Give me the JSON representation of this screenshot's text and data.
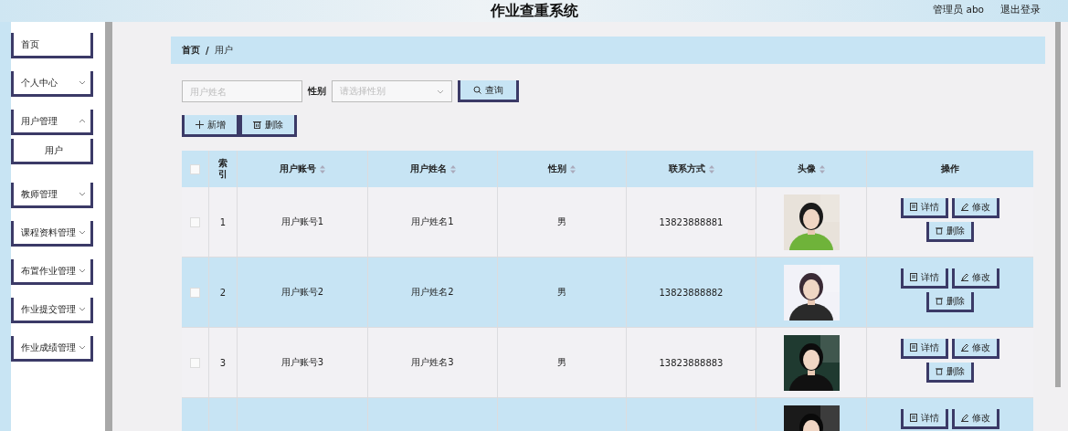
{
  "header": {
    "title": "作业查重系统",
    "user": "管理员 abo",
    "logout": "退出登录"
  },
  "sidebar": {
    "items": [
      {
        "label": "首页",
        "kind": "link"
      },
      {
        "label": "个人中心",
        "kind": "group",
        "expanded": false
      },
      {
        "label": "用户管理",
        "kind": "group",
        "expanded": true,
        "children": [
          {
            "label": "用户",
            "selected": true
          }
        ]
      },
      {
        "label": "教师管理",
        "kind": "group",
        "expanded": false
      },
      {
        "label": "课程资料管理",
        "kind": "group",
        "expanded": false
      },
      {
        "label": "布置作业管理",
        "kind": "group",
        "expanded": false
      },
      {
        "label": "作业提交管理",
        "kind": "group",
        "expanded": false
      },
      {
        "label": "作业成绩管理",
        "kind": "group",
        "expanded": false
      }
    ]
  },
  "breadcrumb": {
    "items": [
      "首页",
      "用户"
    ],
    "separator": "/"
  },
  "search": {
    "name_placeholder": "用户姓名",
    "gender_label": "性别",
    "gender_placeholder": "请选择性别",
    "query_button": "查询"
  },
  "toolbar": {
    "add_button": "新增",
    "delete_button": "删除"
  },
  "table": {
    "all_checked": false,
    "columns": [
      {
        "label": "索引",
        "kind": "index",
        "sortable": false
      },
      {
        "label": "用户账号",
        "kind": "text",
        "sortable": true
      },
      {
        "label": "用户姓名",
        "kind": "text",
        "sortable": true
      },
      {
        "label": "性别",
        "kind": "text",
        "sortable": true
      },
      {
        "label": "联系方式",
        "kind": "text",
        "sortable": true
      },
      {
        "label": "头像",
        "kind": "picture",
        "sortable": true
      },
      {
        "label": "操作",
        "kind": "actions",
        "sortable": false
      }
    ],
    "rows": [
      {
        "checked": false,
        "cells": [
          "1",
          "用户账号1",
          "用户姓名1",
          "男",
          "13823888881"
        ],
        "actions": [
          "详情",
          "修改",
          "删除"
        ]
      },
      {
        "checked": false,
        "cells": [
          "2",
          "用户账号2",
          "用户姓名2",
          "男",
          "13823888882"
        ],
        "actions": [
          "详情",
          "修改",
          "删除"
        ]
      },
      {
        "checked": false,
        "cells": [
          "3",
          "用户账号3",
          "用户姓名3",
          "男",
          "13823888883"
        ],
        "actions": [
          "详情",
          "修改",
          "删除"
        ]
      },
      {
        "cells": [],
        "actions": [
          "详情",
          "修改"
        ]
      }
    ]
  }
}
